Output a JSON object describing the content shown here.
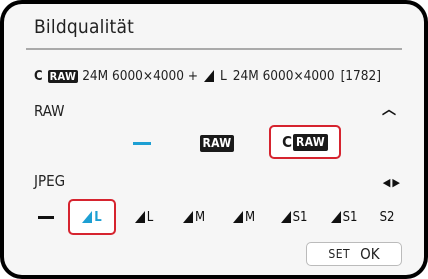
{
  "title": "Bildqualität",
  "summary": {
    "raw_prefix": "C",
    "raw_badge": "RAW",
    "raw_info": "24M 6000×4000 +",
    "jpeg_quality": "L",
    "jpeg_info": "24M 6000×4000",
    "shots": "[1782]"
  },
  "raw_row": {
    "label": "RAW",
    "nav_icon": "up-chevron",
    "options": [
      {
        "label": "−",
        "selected": false
      },
      {
        "label": "RAW",
        "selected": false
      },
      {
        "prefix": "C",
        "label": "RAW",
        "selected": true
      }
    ]
  },
  "jpeg_row": {
    "label": "JPEG",
    "nav_icon": "left-right-arrows",
    "options": [
      {
        "label": "−",
        "selected": false
      },
      {
        "label": "L",
        "selected": true
      },
      {
        "label": "L",
        "selected": false
      },
      {
        "label": "M",
        "selected": false
      },
      {
        "label": "M",
        "selected": false
      },
      {
        "label": "S1",
        "selected": false
      },
      {
        "label": "S1",
        "selected": false
      },
      {
        "label": "S2",
        "selected": false
      }
    ]
  },
  "footer": {
    "set_label": "SET",
    "ok_label": "OK"
  },
  "colors": {
    "selection": "#d6242f",
    "accent": "#1d9fd3"
  }
}
